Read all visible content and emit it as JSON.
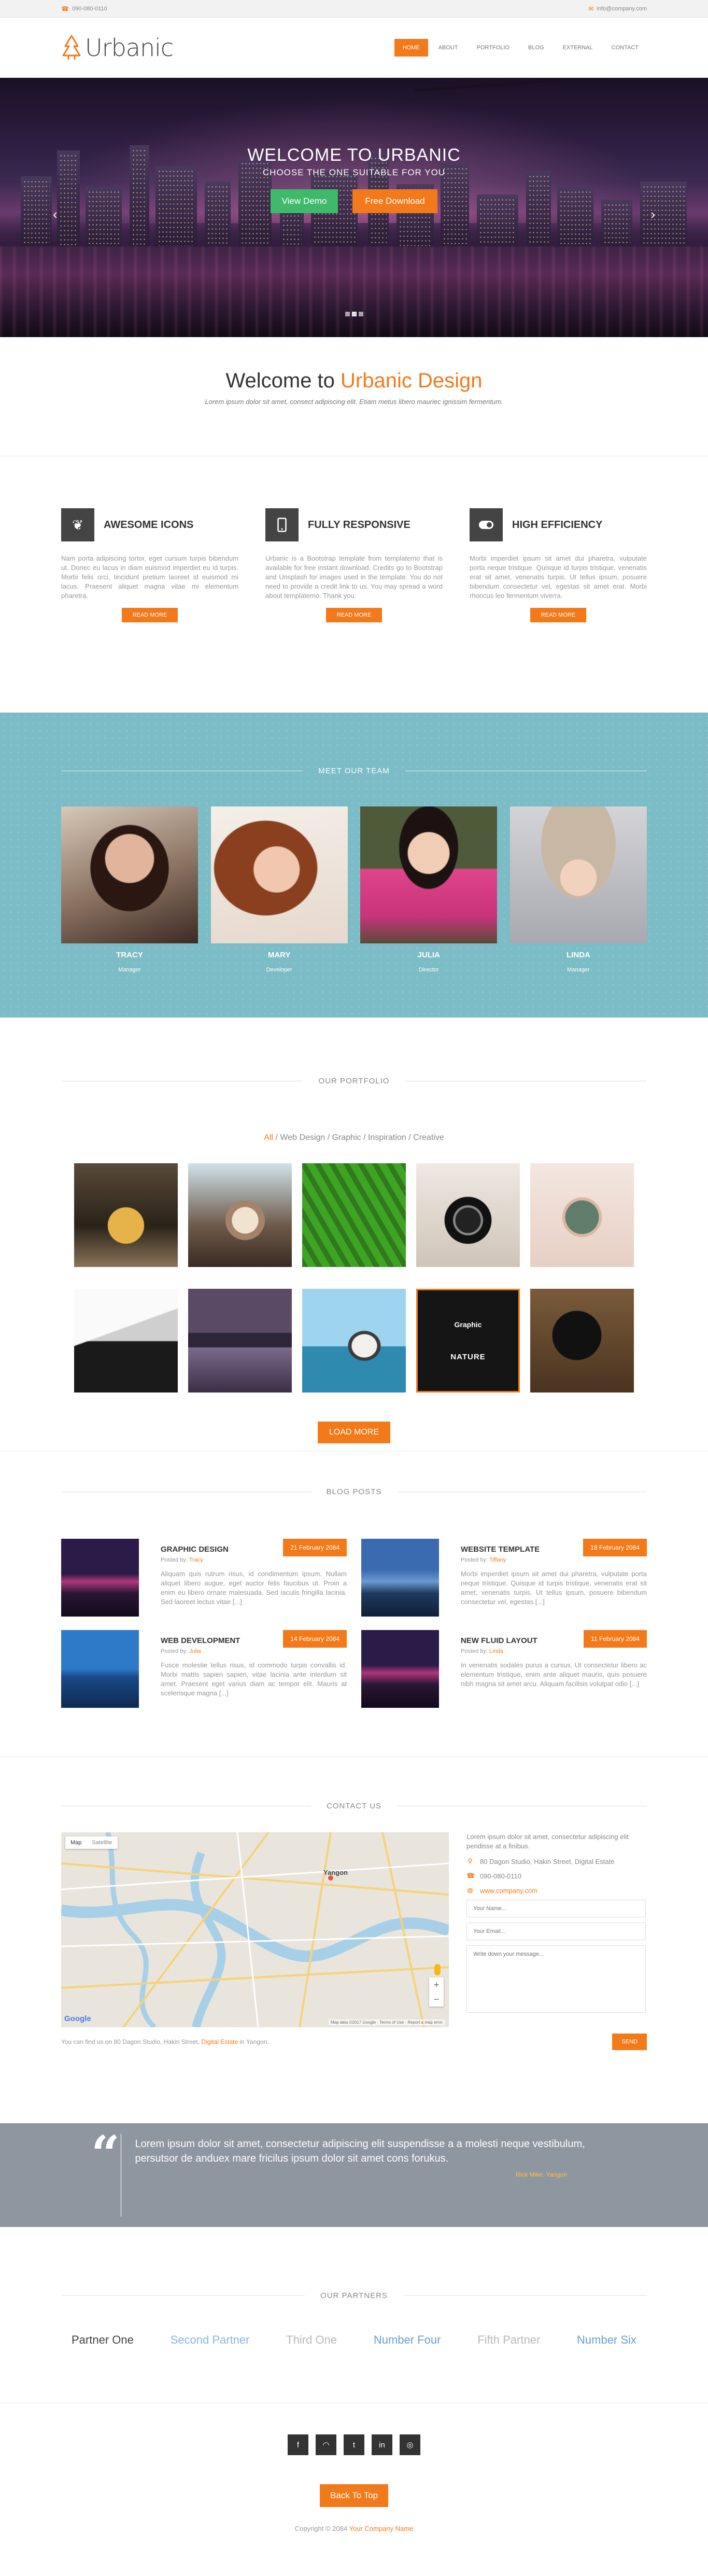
{
  "topbar": {
    "phone": "090-080-0110",
    "email": "info@company.com"
  },
  "header": {
    "logo": "Urbanic",
    "nav": [
      "HOME",
      "ABOUT",
      "PORTFOLIO",
      "BLOG",
      "EXTERNAL",
      "CONTACT"
    ],
    "active": "HOME"
  },
  "hero": {
    "title": "WELCOME TO URBANIC",
    "subtitle": "CHOOSE THE ONE SUITABLE FOR YOU",
    "btn_demo": "View Demo",
    "btn_download": "Free Download",
    "slides": 3,
    "active_slide": 2
  },
  "welcome": {
    "title_a": "Welcome to",
    "title_b": "Urbanic Design",
    "subtitle": "Lorem ipsum dolor sit amet, consect adipiscing elit. Etiam metus libero mauriec ignissim fermentum."
  },
  "features": [
    {
      "icon": "leaf-icon",
      "title": "AWESOME ICONS",
      "text": "Nam porta adipiscing tortor, eget cursum turpis bibendum ut. Donec eu lacus in diam euismod imperdiet eu id turpis. Morbi felis orci, tincidunt pretium laoreet id euismod mi lacus. Praesent aliquet magna vitae mi elementum pharetra.",
      "btn": "READ MORE"
    },
    {
      "icon": "mobile-icon",
      "title": "FULLY RESPONSIVE",
      "text": "Urbanic is a Bootstrap template from templatemo that is available for free instant download. Credits go to Bootstrap and Unsplash for images used in the template. You do not need to provide a credit link to us. You may spread a word about templatemo. Thank you.",
      "btn": "READ MORE"
    },
    {
      "icon": "toggle-icon",
      "title": "HIGH EFFICIENCY",
      "text": "Morbi imperdiet ipsum sit amet dui pharetra, vulputate porta neque tristique. Quisque id turpis tristique, venenatis erat sit amet, venenatis turpis. Ut tellus ipsum, posuere bibendum consectetur vel, egestas sit amet erat. Morbi rhoncus leo fermentum viverra.",
      "btn": "READ MORE"
    }
  ],
  "team": {
    "heading": "MEET OUR TEAM",
    "members": [
      {
        "name": "TRACY",
        "role": "Manager"
      },
      {
        "name": "MARY",
        "role": "Developer"
      },
      {
        "name": "JULIA",
        "role": "Director"
      },
      {
        "name": "LINDA",
        "role": "Manager"
      }
    ]
  },
  "portfolio": {
    "heading": "OUR PORTFOLIO",
    "filters": [
      "All",
      "Web Design",
      "Graphic",
      "Inspiration",
      "Creative"
    ],
    "hover_title": "Graphic",
    "hover_sub": "NATURE",
    "load_more": "LOAD MORE"
  },
  "blog": {
    "heading": "BLOG POSTS",
    "posts": [
      {
        "title": "GRAPHIC DESIGN",
        "date": "21 February 2084",
        "posted_by": "Posted by:",
        "author": "Tracy",
        "text": "Aliquam quis rutrum risus, id condimentum ipsum. Nullam aliquet libero augue, eget auctor felis faucibus ut. Proin a enim eu libero ornare malesuada. Sed iaculis fringilla lacinia. Sed laoreet lectus vitae [...]"
      },
      {
        "title": "WEBSITE TEMPLATE",
        "date": "18 February 2084",
        "posted_by": "Posted by:",
        "author": "Tiffany",
        "text": "Morbi imperdiet ipsum sit amet dui pharetra, vulputate porta neque tristique. Quisque id turpis tristique, venenatis erat sit amet, venenatis turpis. Ut tellus ipsum, posuere bibendum consectetur vel, egestas [...]"
      },
      {
        "title": "WEB DEVELOPMENT",
        "date": "14 February 2084",
        "posted_by": "Posted by:",
        "author": "Julia",
        "text": "Fusce molestie tellus risus, id commodo turpis convallis id. Morbi mattis sapien sapien, vitae lacinia ante interdum sit amet. Praesent eget varius diam ac tempor elit. Mauris at scelerisque magna [...]"
      },
      {
        "title": "NEW FLUID LAYOUT",
        "date": "11 February 2084",
        "posted_by": "Posted by:",
        "author": "Linda",
        "text": "In venenatis sodales purus a cursus. Ut consectetur libero ac elementum tristique, enim ante aliquet mauris, quis posuere nibh magna sit amet arcu. Aliquam facilisis volutpat odio [...]"
      }
    ]
  },
  "contact": {
    "heading": "CONTACT US",
    "intro": "Lorem ipsum dolor sit amet, consectetur adipiscing elit pendisse at a finibus.",
    "address": "80 Dagon Studio, Hakin Street, Digital Estate",
    "phone": "090-080-0110",
    "website": "www.company.com",
    "name_ph": "Your Name...",
    "email_ph": "Your Email...",
    "message_ph": "Write down your message...",
    "send": "SEND",
    "note_a": "You can find us on 80 Dagon Studio, Hakin Street,",
    "note_link": "Digital Estate",
    "note_b": "in Yangon.",
    "map_tabs": [
      "Map",
      "Satellite"
    ],
    "map_city": "Yangon",
    "map_google": "Google",
    "map_terms": "Map data ©2017 Google  ·  Terms of Use  ·  Report a map error"
  },
  "quote": {
    "text": "Lorem ipsum dolor sit amet, consectetur adipiscing elit suspendisse a a molesti neque vestibulum, persutsor de anduex mare fricilus ipsum dolor sit amet cons forukus.",
    "author": "Rick Mike, Yangon"
  },
  "partners": {
    "heading": "OUR PARTNERS",
    "items": [
      {
        "name": "Partner One",
        "color": "#444444"
      },
      {
        "name": "Second Partner",
        "color": "#8ab8d8"
      },
      {
        "name": "Third One",
        "color": "#b9b9b9"
      },
      {
        "name": "Number Four",
        "color": "#6a9fd4"
      },
      {
        "name": "Fifth Partner",
        "color": "#b9b9b9"
      },
      {
        "name": "Number Six",
        "color": "#6a9fd4"
      }
    ]
  },
  "footer": {
    "social": [
      {
        "icon": "facebook-icon",
        "glyph": "f"
      },
      {
        "icon": "rss-icon",
        "glyph": "◠"
      },
      {
        "icon": "twitter-icon",
        "glyph": "t"
      },
      {
        "icon": "linkedin-icon",
        "glyph": "in"
      },
      {
        "icon": "dribbble-icon",
        "glyph": "◎"
      }
    ],
    "to_top": "Back To Top",
    "copy_a": "Copyright © 2084",
    "copy_link": "Your Company Name"
  },
  "colors": {
    "accent": "#f27a1a",
    "green": "#3fb96b",
    "team_bg": "#7cbcc6",
    "quote_bg": "#8e96a0"
  }
}
